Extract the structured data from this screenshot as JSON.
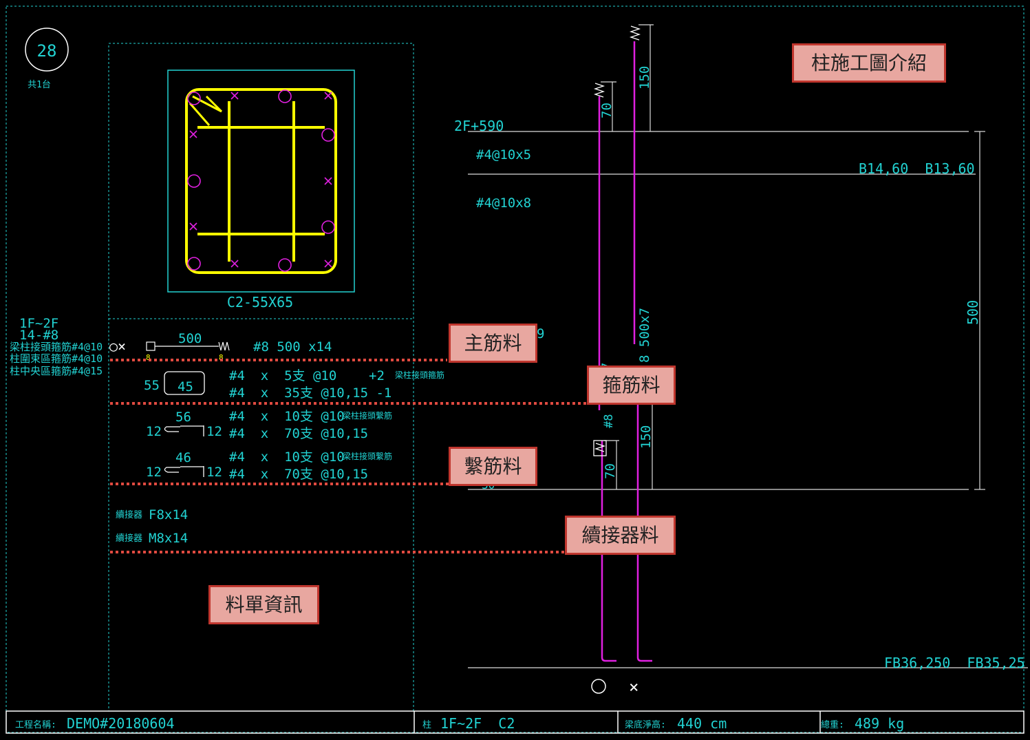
{
  "sheet": {
    "number": "28",
    "count": "共1台"
  },
  "title_label": "柱施工圖介紹",
  "callouts": {
    "main_rebar": "主筋料",
    "stirrup": "箍筋料",
    "tie": "繫筋料",
    "coupler": "續接器料",
    "bom": "料單資訊"
  },
  "section": {
    "name": "C2-55X65"
  },
  "left_notes": {
    "floor_range": "1F~2F",
    "bar_count": "14-#8",
    "joint_stirrup": "梁柱接頭箍筋#4@10",
    "confine_stirrup": "柱圍束區箍筋#4@10",
    "middle_stirrup": "柱中央區箍筋#4@15"
  },
  "bom": {
    "main": {
      "length": "500",
      "spec": "#8 500 x14",
      "symbols": "○×"
    },
    "stirrup": {
      "w": "55",
      "h": "45",
      "row1": "#4  x  5支 @10",
      "row1_extra": "+2",
      "row1_note": "梁柱接頭箍筋",
      "row2": "#4  x  35支 @10,15 -1"
    },
    "tie1": {
      "len": "56",
      "hook_l": "12",
      "hook_r": "12",
      "row1": "#4  x  10支 @10",
      "row1_note": "梁柱接頭繫筋",
      "row2": "#4  x  70支 @10,15"
    },
    "tie2": {
      "len": "46",
      "hook_l": "12",
      "hook_r": "12",
      "row1": "#4  x  10支 @10",
      "row1_note": "梁柱接頭繫筋",
      "row2": "#4  x  70支 @10,15"
    },
    "coupler1": {
      "label": "續接器",
      "spec": "F8x14"
    },
    "coupler2": {
      "label": "續接器",
      "spec": "M8x14"
    }
  },
  "elevation": {
    "level_top": "2F+590",
    "hoop_top": "#4@10x5",
    "hoop_mid": "#4@10x8",
    "beam_top": "B14,60  B13,60",
    "beam_bot": "FB36,250  FB35,25",
    "dim_150_top": "150",
    "dim_70_top": "70",
    "dim_500x7": "8 500x7",
    "dim_7": "7",
    "dim_8": "#8",
    "dim_150_bot": "150",
    "dim_70_bot": "70",
    "dim_height": "500",
    "partial_9": "9",
    "partial_30": "30",
    "sym_circle": "○",
    "sym_cross": "×"
  },
  "footer": {
    "project_label": "工程名稱:",
    "project_value": "DEMO#20180604",
    "column_prefix": "柱",
    "column_value": "1F~2F  C2",
    "clear_height_label": "梁底淨高:",
    "clear_height_value": "440 cm",
    "weight_label": "總重:",
    "weight_value": "489 kg"
  },
  "colors": {
    "cyan": "#22d3d3",
    "yellow": "#ffff00",
    "magenta": "#e020e0",
    "white": "#ffffff",
    "red": "#c0362e",
    "pink": "#e8a7a0"
  }
}
